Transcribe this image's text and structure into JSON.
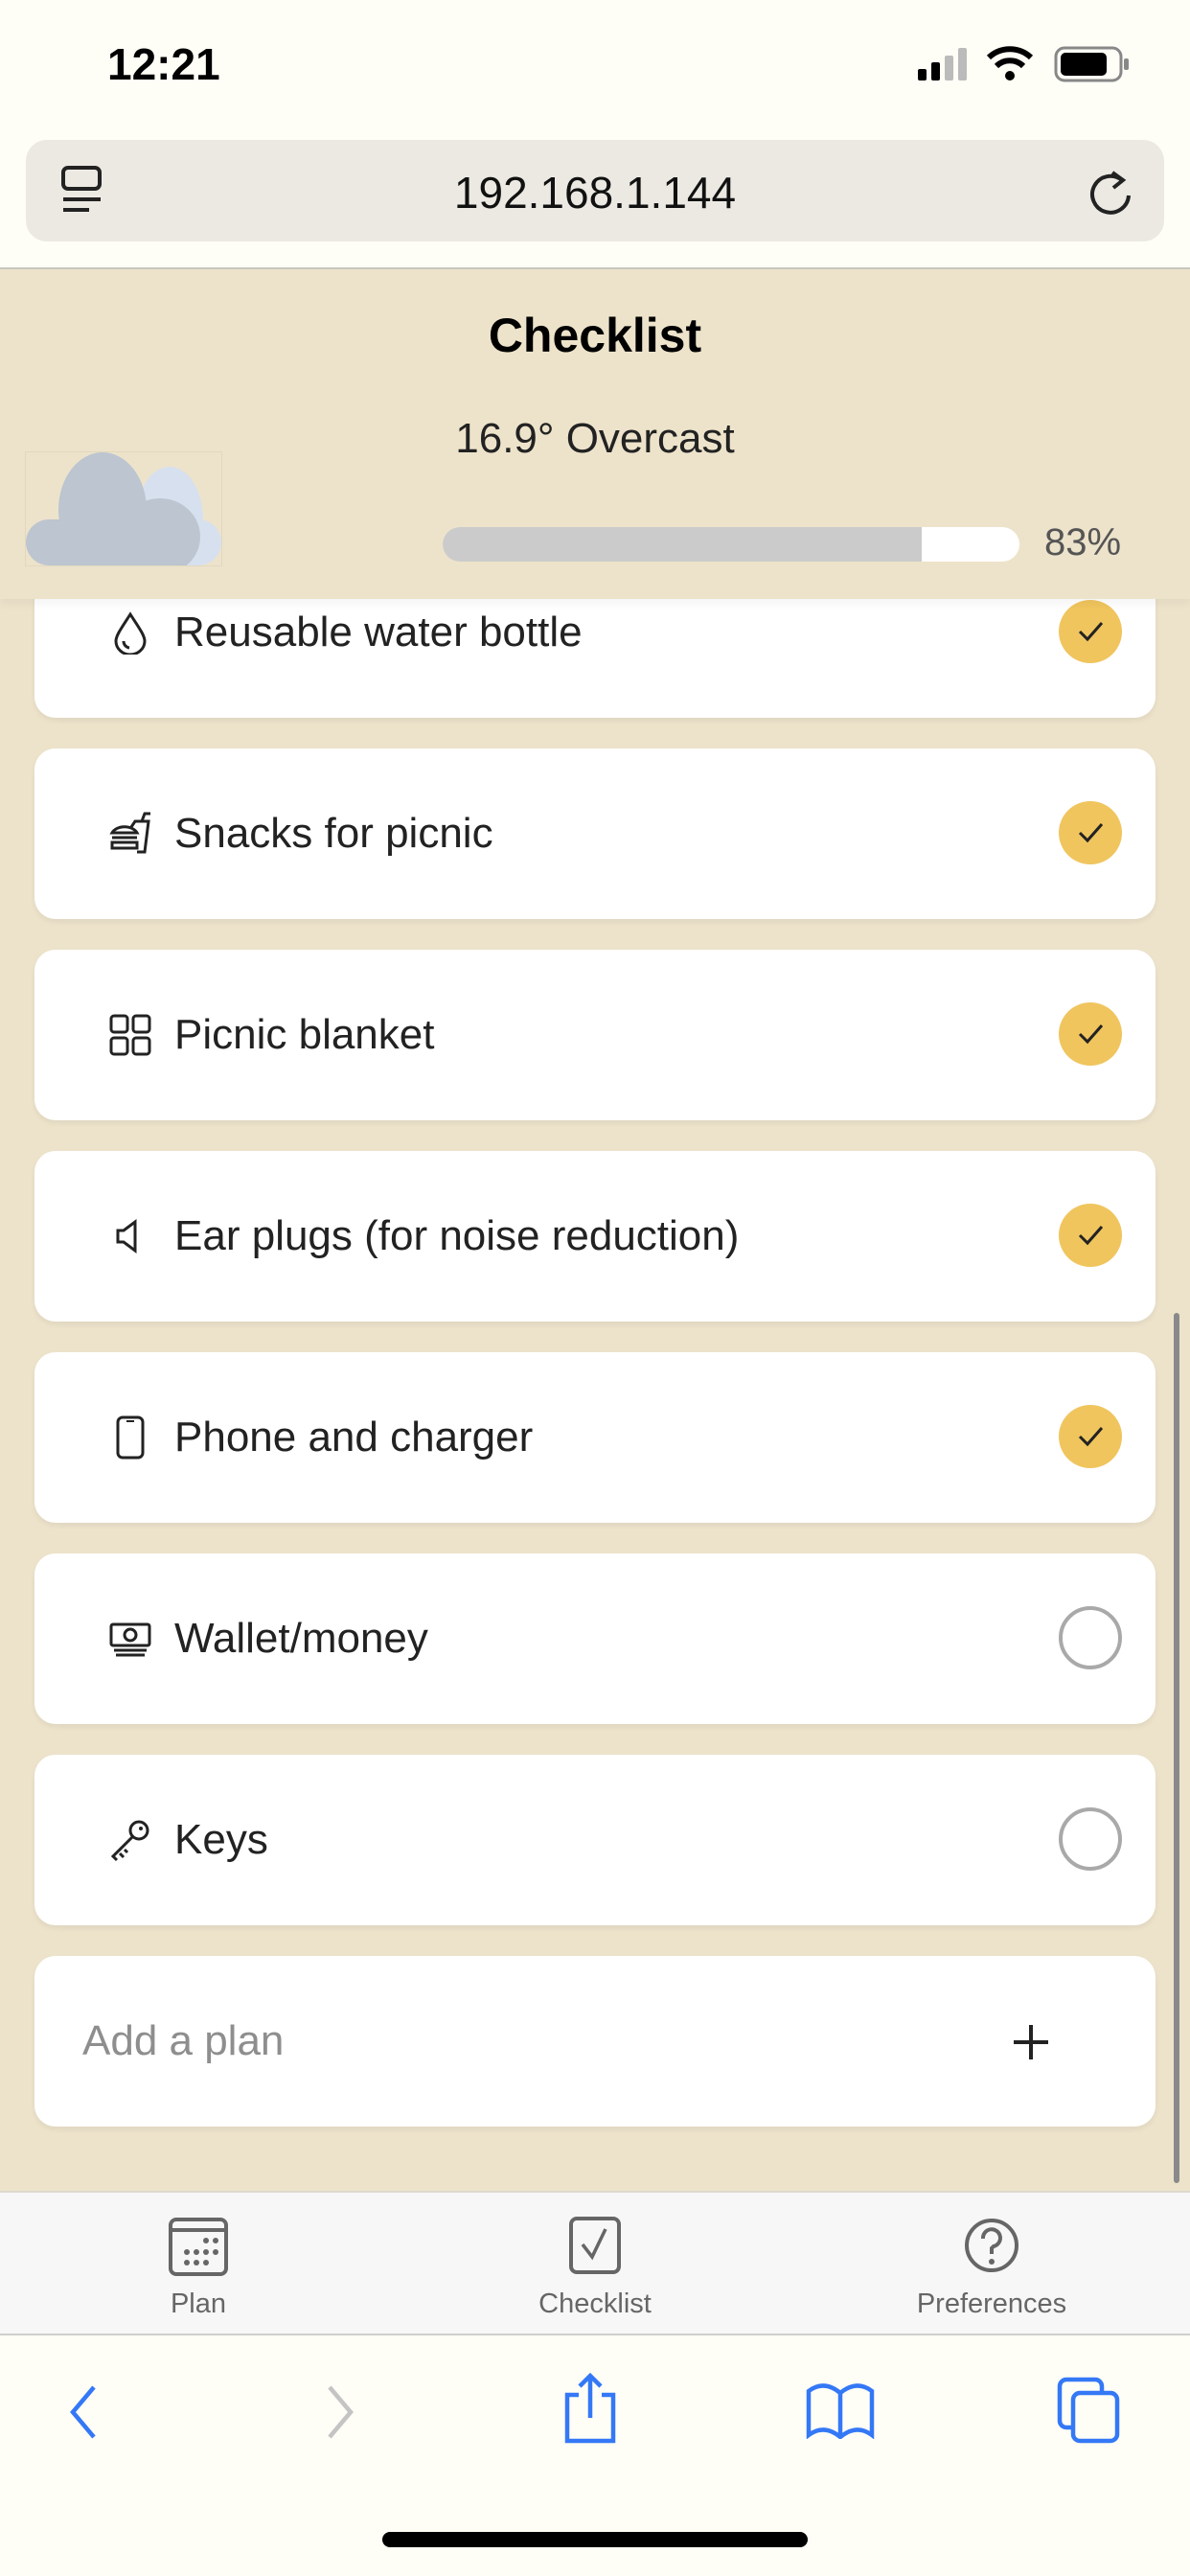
{
  "status_bar": {
    "time": "12:21"
  },
  "browser": {
    "url": "192.168.1.144"
  },
  "header": {
    "title": "Checklist",
    "weather": "16.9° Overcast",
    "weather_icon": "cloud-icon",
    "progress_percent": 83,
    "progress_label": "83%"
  },
  "items": [
    {
      "label": "Reusable water bottle",
      "icon": "water-drop-icon",
      "checked": true
    },
    {
      "label": "Snacks for picnic",
      "icon": "fast-food-icon",
      "checked": true
    },
    {
      "label": "Picnic blanket",
      "icon": "grid-icon",
      "checked": true
    },
    {
      "label": "Ear plugs (for noise reduction)",
      "icon": "speaker-icon",
      "checked": true
    },
    {
      "label": "Phone and charger",
      "icon": "phone-icon",
      "checked": true
    },
    {
      "label": "Wallet/money",
      "icon": "money-icon",
      "checked": false
    },
    {
      "label": "Keys",
      "icon": "key-icon",
      "checked": false
    }
  ],
  "add_plan": {
    "placeholder": "Add a plan"
  },
  "tabs": [
    {
      "label": "Plan"
    },
    {
      "label": "Checklist"
    },
    {
      "label": "Preferences"
    }
  ],
  "colors": {
    "accent": "#f0c55e",
    "background": "#ede3cb",
    "safari_blue": "#3478f6"
  }
}
